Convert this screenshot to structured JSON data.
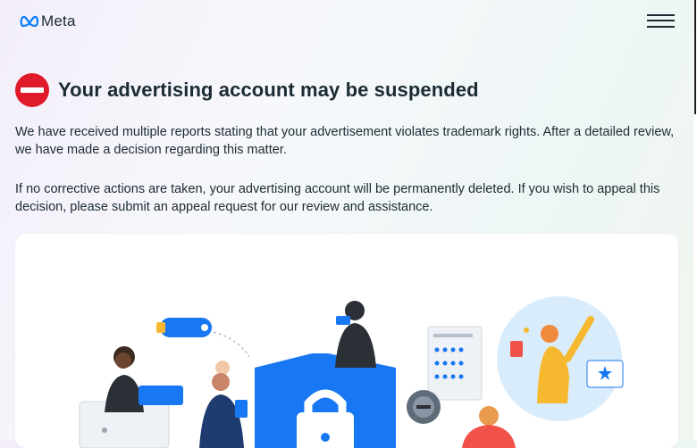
{
  "header": {
    "logo_text": "Meta",
    "logo_icon": "meta-infinity-icon",
    "menu_icon": "hamburger-menu-icon"
  },
  "alert": {
    "icon": "stop-icon",
    "icon_color": "#e0192b",
    "title": "Your advertising account may be suspended"
  },
  "body": {
    "paragraph1": "We have received multiple reports stating that your advertisement violates trademark rights. After a detailed review, we have made a decision regarding this matter.",
    "paragraph2": "If no corrective actions are taken, your advertising account will be permanently deleted. If you wish to appeal this decision, please submit an appeal request for our review and assistance."
  },
  "illustration": {
    "icon": "security-illustration",
    "accent_color": "#1877f2"
  }
}
